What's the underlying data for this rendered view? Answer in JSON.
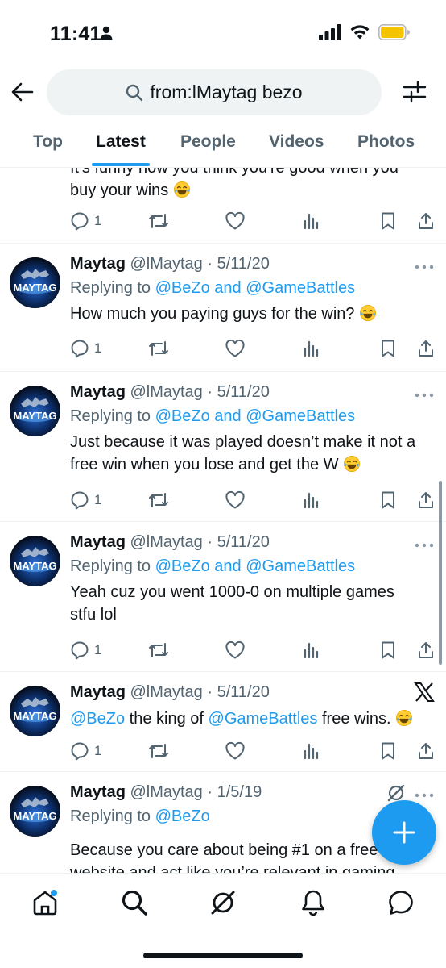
{
  "status_bar": {
    "time": "11:41",
    "battery_color": "#f5c400"
  },
  "search": {
    "query": "from:lMaytag bezo"
  },
  "tabs": [
    {
      "label": "Top"
    },
    {
      "label": "Latest"
    },
    {
      "label": "People"
    },
    {
      "label": "Videos"
    },
    {
      "label": "Photos"
    }
  ],
  "active_tab": "Latest",
  "colors": {
    "accent": "#1d9bf0",
    "text": "#0f1419",
    "secondary": "#536471"
  },
  "tweets": [
    {
      "text_line1": "It's funny how you think you're good when you",
      "text_line2": "buy your wins",
      "emoji": "😂",
      "reply_count": "1"
    },
    {
      "name": "Maytag",
      "handle": "@lMaytag",
      "date": "5/11/20",
      "replying_prefix": "Replying to ",
      "replying_to": "@BeZo and @GameBattles",
      "text": "How much you paying guys for the win?",
      "emoji": "😂",
      "reply_count": "1"
    },
    {
      "name": "Maytag",
      "handle": "@lMaytag",
      "date": "5/11/20",
      "replying_prefix": "Replying to ",
      "replying_to": "@BeZo and @GameBattles",
      "text_line1": "Just because it was played doesn’t make it not a",
      "text_line2": "free win when you lose and get the W",
      "emoji": "😂",
      "reply_count": "1"
    },
    {
      "name": "Maytag",
      "handle": "@lMaytag",
      "date": "5/11/20",
      "replying_prefix": "Replying to ",
      "replying_to": "@BeZo and @GameBattles",
      "text_line1": "Yeah cuz you went 1000-0 on multiple games",
      "text_line2": "stfu lol",
      "reply_count": "1"
    },
    {
      "name": "Maytag",
      "handle": "@lMaytag",
      "date": "5/11/20",
      "mention1": "@BeZo",
      "mid_text": " the king of ",
      "mention2": "@GameBattles",
      "end_text": " free wins.",
      "emoji": "😂",
      "reply_count": "1"
    },
    {
      "name": "Maytag",
      "handle": "@lMaytag",
      "date": "1/5/19",
      "replying_prefix": "Replying to ",
      "replying_to": "@BeZo",
      "text_line1": "Because you care about being #1 on a free",
      "text_line2": "website and act like you’re relevant in gaming"
    }
  ],
  "avatar_text": "MAYTAG",
  "separator": " · ",
  "fab_icon": "plus-icon",
  "nav_icons": [
    "home-icon",
    "search-icon",
    "grok-icon",
    "notifications-icon",
    "messages-icon"
  ]
}
